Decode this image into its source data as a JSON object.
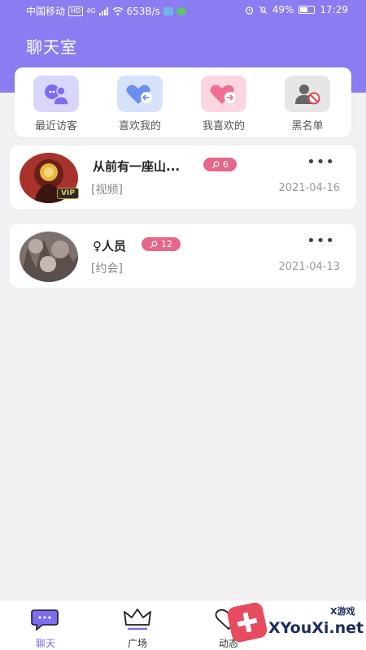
{
  "status_bar": {
    "carrier": "中国移动",
    "net_badge": "HD",
    "net_type": "4G",
    "speed": "653B/s",
    "battery": "49%",
    "time": "17:29"
  },
  "header": {
    "title": "聊天室"
  },
  "quick_actions": [
    {
      "label": "最近访客",
      "icon": "visitor-icon",
      "bg": "#d9d6fb",
      "color": "#7b6cf0"
    },
    {
      "label": "喜欢我的",
      "icon": "heart-in-icon",
      "bg": "#d6e2fb",
      "color": "#6c8ef0"
    },
    {
      "label": "我喜欢的",
      "icon": "heart-out-icon",
      "bg": "#fbd6e0",
      "color": "#ef6f93"
    },
    {
      "label": "黑名单",
      "icon": "blocked-user-icon",
      "bg": "#e6e6e6",
      "color": "#666666"
    }
  ],
  "chats": [
    {
      "name": "从前有一座山...",
      "badge": "6",
      "message": "[视频]",
      "date": "2021-04-16",
      "vip": "VIP",
      "more": "•••"
    },
    {
      "name": "♀人员",
      "badge": "12",
      "message": "[约会]",
      "date": "2021-04-13",
      "more": "•••"
    }
  ],
  "tabs": [
    {
      "label": "聊天",
      "icon": "chat-icon",
      "active": true
    },
    {
      "label": "广场",
      "icon": "crown-icon",
      "active": false
    },
    {
      "label": "动态",
      "icon": "heart-icon",
      "active": false
    }
  ],
  "watermark": {
    "text": "XYouXi.net",
    "small": "X游戏"
  },
  "colors": {
    "accent": "#8b7cf2",
    "badge": "#e8668a"
  }
}
